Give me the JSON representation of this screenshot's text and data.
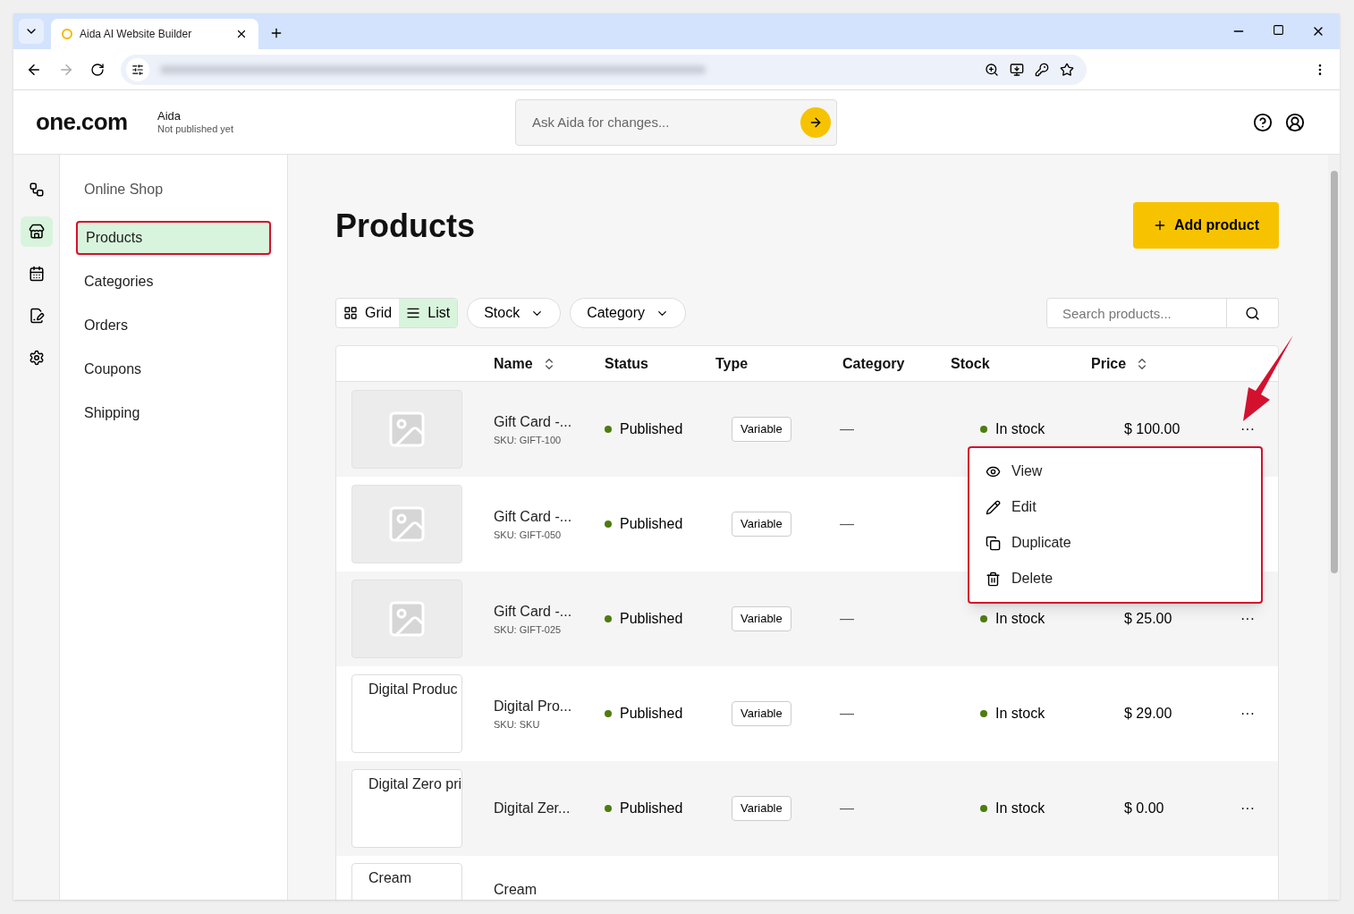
{
  "browser": {
    "tab_title": "Aida AI Website Builder"
  },
  "header": {
    "logo": "one.com",
    "site_name": "Aida",
    "site_status": "Not published yet",
    "ask_placeholder": "Ask Aida for changes..."
  },
  "rail": [
    {
      "selected": false
    },
    {
      "selected": true
    },
    {
      "selected": false
    },
    {
      "selected": false
    },
    {
      "selected": false
    }
  ],
  "sidebar": {
    "title": "Online Shop",
    "items": [
      {
        "label": "Products",
        "selected": true
      },
      {
        "label": "Categories",
        "selected": false
      },
      {
        "label": "Orders",
        "selected": false
      },
      {
        "label": "Coupons",
        "selected": false
      },
      {
        "label": "Shipping",
        "selected": false
      }
    ]
  },
  "page_title": "Products",
  "add_button": "Add product",
  "view_toggle": [
    {
      "label": "Grid",
      "selected": false
    },
    {
      "label": "List",
      "selected": true
    }
  ],
  "filters": [
    "Stock",
    "Category"
  ],
  "search": {
    "placeholder": "Search products..."
  },
  "columns": [
    {
      "label": "Name",
      "sortable": true
    },
    {
      "label": "Status",
      "sortable": false
    },
    {
      "label": "Type",
      "sortable": false
    },
    {
      "label": "Category",
      "sortable": false
    },
    {
      "label": "Stock",
      "sortable": false
    },
    {
      "label": "Price",
      "sortable": true
    }
  ],
  "rows": [
    {
      "image": {
        "kind": "placeholder"
      },
      "name": "Gift Card -...",
      "sku": "SKU: GIFT-100",
      "status": "Published",
      "type": "Variable",
      "category": "—",
      "stock": "In stock",
      "price": "$ 100.00",
      "more": "···"
    },
    {
      "image": {
        "kind": "placeholder"
      },
      "name": "Gift Card -...",
      "sku": "SKU: GIFT-050",
      "status": "Published",
      "type": "Variable",
      "category": "—"
    },
    {
      "image": {
        "kind": "placeholder"
      },
      "name": "Gift Card -...",
      "sku": "SKU: GIFT-025",
      "status": "Published",
      "type": "Variable",
      "category": "—",
      "stock": "In stock",
      "price": "$ 25.00",
      "more": "···"
    },
    {
      "image": {
        "kind": "broken",
        "alt": "Digital Produc"
      },
      "name": "Digital Pro...",
      "sku": "SKU: SKU",
      "status": "Published",
      "type": "Variable",
      "category": "—",
      "stock": "In stock",
      "price": "$ 29.00",
      "more": "···"
    },
    {
      "image": {
        "kind": "broken",
        "alt": "Digital Zero pri"
      },
      "name": "Digital Zer...",
      "status": "Published",
      "type": "Variable",
      "category": "—",
      "stock": "In stock",
      "price": "$ 0.00",
      "more": "···"
    },
    {
      "image": {
        "kind": "broken",
        "alt": "Cream"
      },
      "name": "Cream"
    }
  ],
  "menu": [
    "View",
    "Edit",
    "Duplicate",
    "Delete"
  ]
}
